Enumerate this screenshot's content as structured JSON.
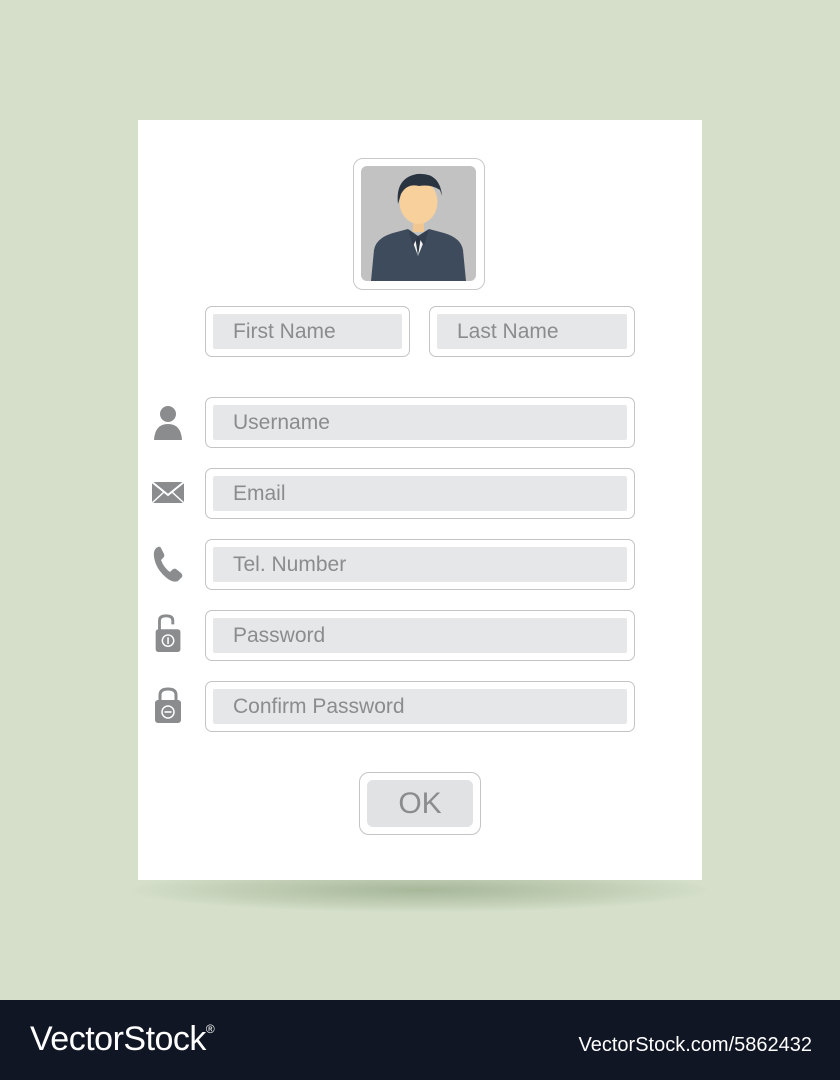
{
  "form": {
    "first_name": {
      "placeholder": "First Name",
      "value": ""
    },
    "last_name": {
      "placeholder": "Last Name",
      "value": ""
    },
    "username": {
      "placeholder": "Username",
      "value": "",
      "icon": "user-icon"
    },
    "email": {
      "placeholder": "Email",
      "value": "",
      "icon": "envelope-icon"
    },
    "phone": {
      "placeholder": "Tel. Number",
      "value": "",
      "icon": "phone-icon"
    },
    "password": {
      "placeholder": "Password",
      "value": "",
      "icon": "open-lock-icon"
    },
    "confirm_password": {
      "placeholder": "Confirm Password",
      "value": "",
      "icon": "lock-icon"
    },
    "ok_label": "OK",
    "avatar_icon": "user-avatar"
  },
  "watermark": {
    "brand": "VectorStock",
    "registered": "®",
    "id_text": "VectorStock.com/5862432"
  },
  "colors": {
    "background": "#d5dfca",
    "card": "#ffffff",
    "field_fill": "#e6e7e8",
    "text_placeholder": "#8a8c8e",
    "icon": "#8a8c8e",
    "footer": "#101623"
  }
}
